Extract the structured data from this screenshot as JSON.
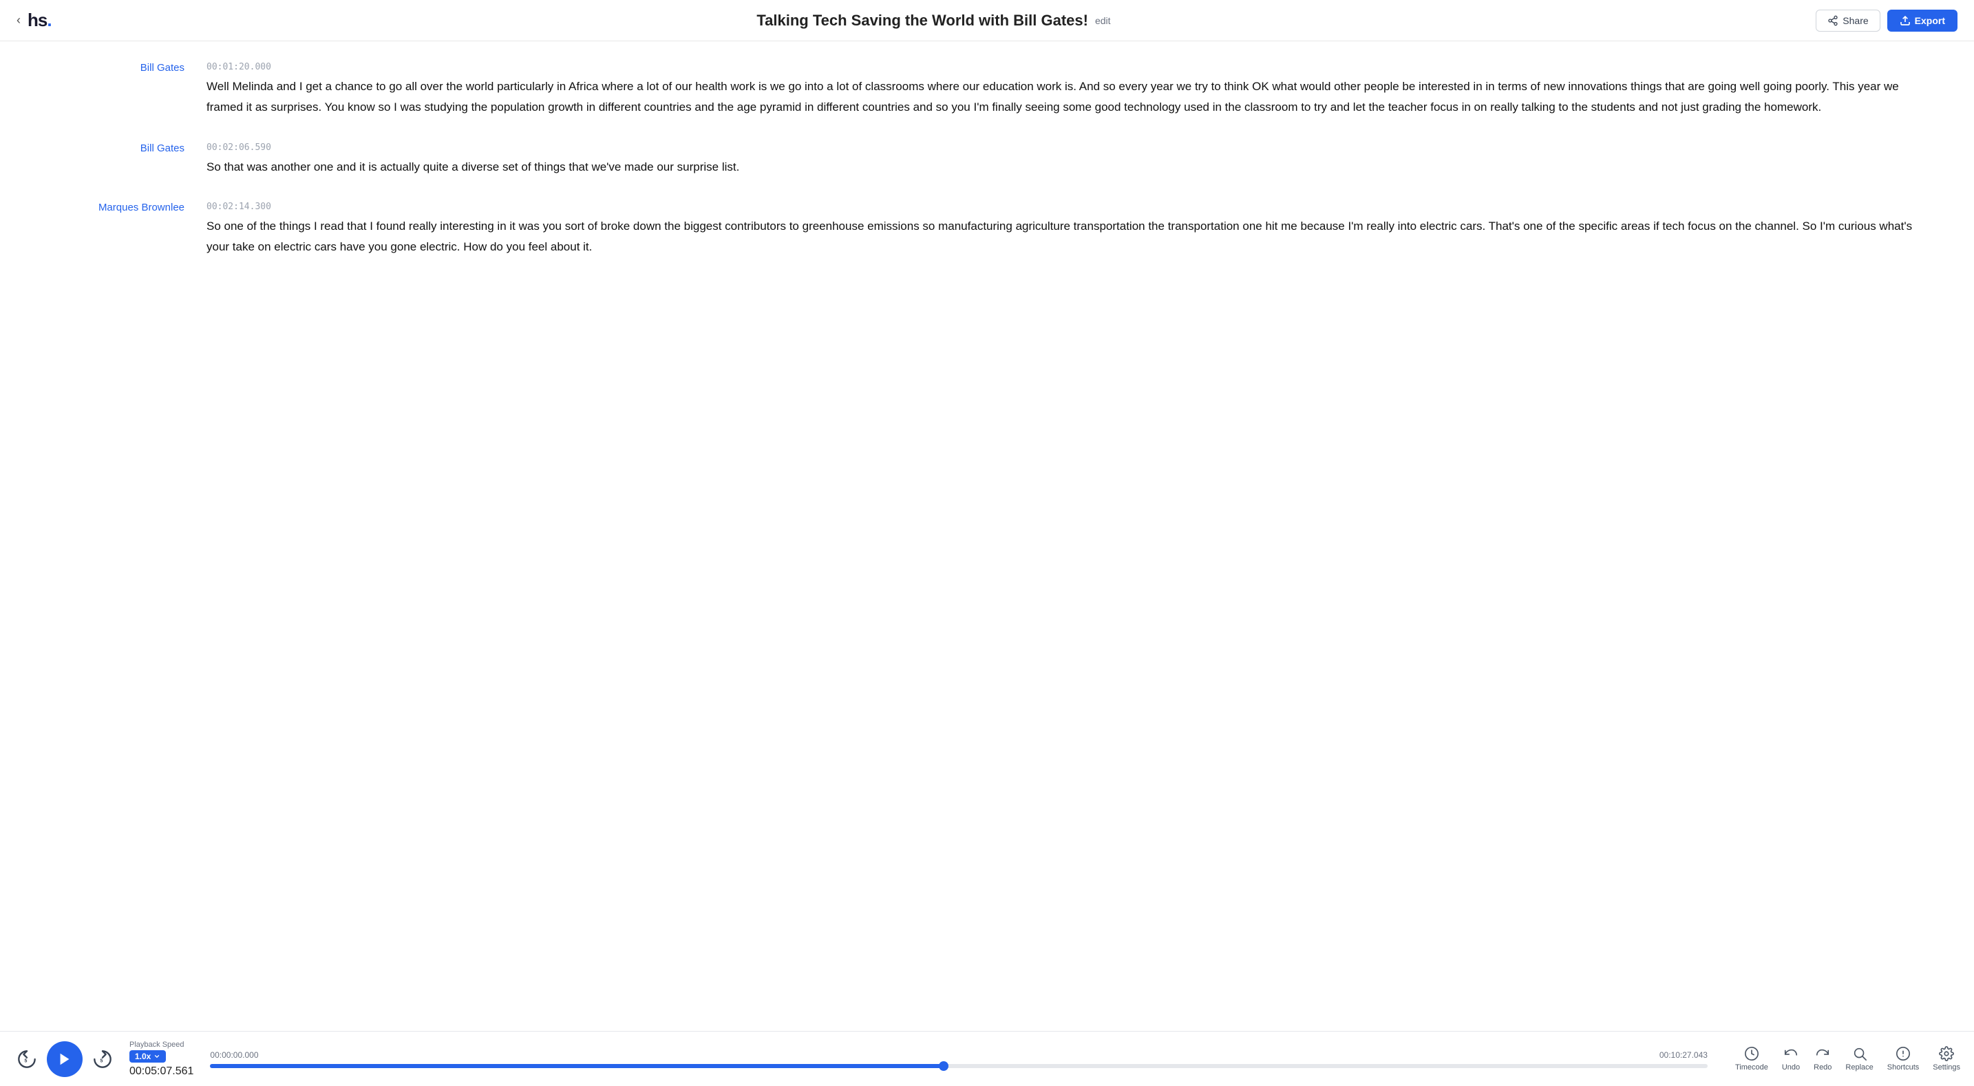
{
  "header": {
    "logo": "hs.",
    "title": "Talking Tech Saving the World with Bill Gates!",
    "edit_label": "edit",
    "share_label": "Share",
    "export_label": "Export"
  },
  "transcript": {
    "blocks": [
      {
        "speaker": "Bill Gates",
        "timestamp": "00:01:20.000",
        "text": "Well Melinda and I get a chance to go all over the world particularly in Africa where a lot of our health work is we go into a lot of classrooms where our education work is. And so every year we try to think OK what would other people be interested in in terms of new innovations things that are going well going poorly. This year we framed it as surprises. You know so I was studying the population growth in different countries and the age pyramid in different countries and so you I'm finally seeing some good technology used in the classroom to try and let the teacher focus in on really talking to the students and not just grading the homework."
      },
      {
        "speaker": "Bill Gates",
        "timestamp": "00:02:06.590",
        "text": " So that was another one and it is actually quite a diverse set of things that we've made our surprise list."
      },
      {
        "speaker": "Marques Brownlee",
        "timestamp": "00:02:14.300",
        "text": "So one of the things I read that I found really interesting in it was you sort of broke down the biggest contributors to greenhouse emissions so manufacturing agriculture transportation the transportation one hit me because I'm really into electric cars. That's one of the specific areas if tech focus on the channel. So I'm curious what's your take on electric cars have you gone electric. How do you feel about it."
      }
    ]
  },
  "player": {
    "playback_speed_label": "Playback Speed",
    "speed_value": "1.0x",
    "current_time": "00:05:07.561",
    "start_time": "00:00:00.000",
    "end_time": "00:10:27.043",
    "progress_percent": 49,
    "skip_back_label": "5",
    "skip_forward_label": "5"
  },
  "toolbar": {
    "timecode_label": "Timecode",
    "undo_label": "Undo",
    "redo_label": "Redo",
    "replace_label": "Replace",
    "shortcuts_label": "Shortcuts",
    "settings_label": "Settings"
  }
}
